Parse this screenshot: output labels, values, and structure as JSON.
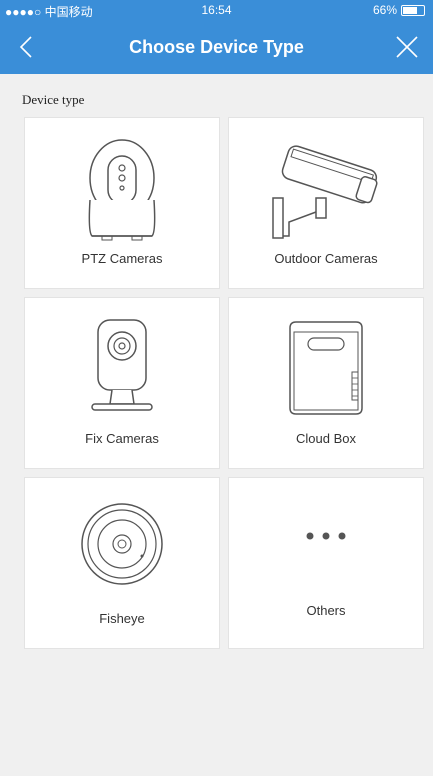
{
  "status_bar": {
    "carrier": "●●●●○ 中国移动",
    "time": "16:54",
    "battery": "66%"
  },
  "nav": {
    "title": "Choose Device Type"
  },
  "section_label": "Device type",
  "devices": [
    {
      "label": "PTZ Cameras",
      "icon": "ptz-camera-icon"
    },
    {
      "label": "Outdoor Cameras",
      "icon": "outdoor-camera-icon"
    },
    {
      "label": "Fix Cameras",
      "icon": "fix-camera-icon"
    },
    {
      "label": "Cloud Box",
      "icon": "cloud-box-icon"
    },
    {
      "label": "Fisheye",
      "icon": "fisheye-camera-icon"
    },
    {
      "label": "Others",
      "icon": "more-dots-icon"
    }
  ],
  "colors": {
    "header": "#3a8ed8",
    "background": "#f0f0f0",
    "tile": "#ffffff"
  }
}
